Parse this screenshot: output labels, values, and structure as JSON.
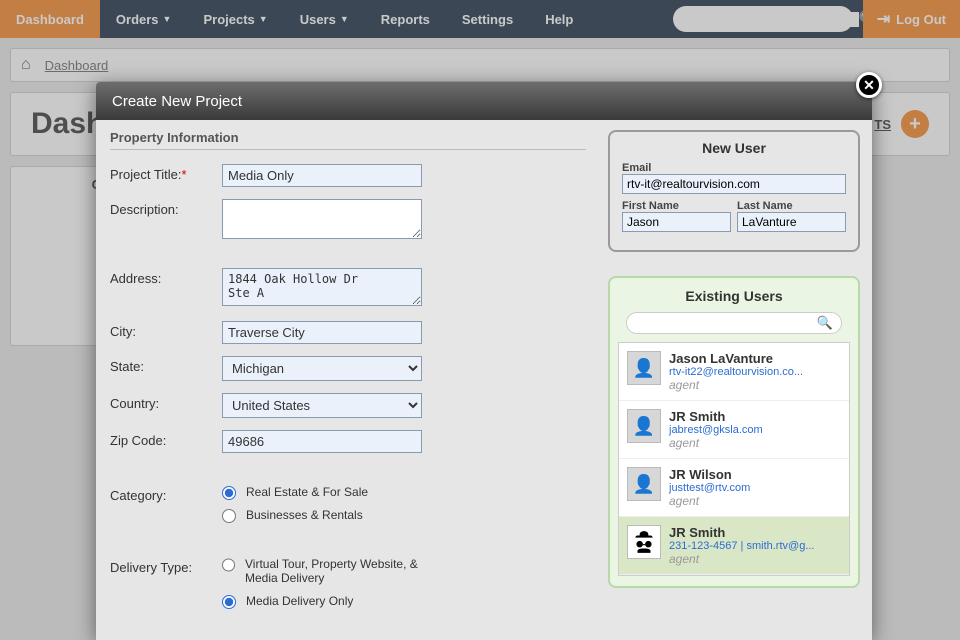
{
  "nav": {
    "items": [
      {
        "label": "Dashboard",
        "active": true,
        "dropdown": false
      },
      {
        "label": "Orders",
        "active": false,
        "dropdown": true
      },
      {
        "label": "Projects",
        "active": false,
        "dropdown": true
      },
      {
        "label": "Users",
        "active": false,
        "dropdown": true
      },
      {
        "label": "Reports",
        "active": false,
        "dropdown": false
      },
      {
        "label": "Settings",
        "active": false,
        "dropdown": false
      },
      {
        "label": "Help",
        "active": false,
        "dropdown": false
      }
    ],
    "search_placeholder": "",
    "logout": "Log Out"
  },
  "breadcrumb": {
    "items": [
      "Dashboard"
    ]
  },
  "page": {
    "title": "Dashboard",
    "tab_letters": "TS",
    "panel_caption": "Custo"
  },
  "modal": {
    "title": "Create New Project",
    "section": "Property Information",
    "labels": {
      "project_title": "Project Title:",
      "description": "Description:",
      "address": "Address:",
      "city": "City:",
      "state": "State:",
      "country": "Country:",
      "zip": "Zip Code:",
      "category": "Category:",
      "delivery": "Delivery Type:"
    },
    "values": {
      "project_title": "Media Only",
      "description": "",
      "address": "1844 Oak Hollow Dr\nSte A",
      "city": "Traverse City",
      "state": "Michigan",
      "country": "United States",
      "zip": "49686"
    },
    "category_options": [
      {
        "label": "Real Estate & For Sale",
        "checked": true
      },
      {
        "label": "Businesses & Rentals",
        "checked": false
      }
    ],
    "delivery_options": [
      {
        "label": "Virtual Tour, Property Website, & Media Delivery",
        "checked": false
      },
      {
        "label": "Media Delivery Only",
        "checked": true
      }
    ]
  },
  "new_user": {
    "title": "New User",
    "labels": {
      "email": "Email",
      "first": "First Name",
      "last": "Last Name"
    },
    "values": {
      "email": "rtv-it@realtourvision.com",
      "first": "Jason",
      "last": "LaVanture"
    }
  },
  "existing_users": {
    "title": "Existing Users",
    "search_value": "",
    "list": [
      {
        "name": "Jason LaVanture",
        "email": "rtv-it22@realtourvision.co...",
        "role": "agent",
        "selected": false,
        "avatar": "default"
      },
      {
        "name": "JR Smith",
        "email": "jabrest@gksla.com",
        "role": "agent",
        "selected": false,
        "avatar": "default"
      },
      {
        "name": "JR Wilson",
        "email": "justtest@rtv.com",
        "role": "agent",
        "selected": false,
        "avatar": "default"
      },
      {
        "name": "JR Smith",
        "email": "231-123-4567 | smith.rtv@g...",
        "role": "agent",
        "selected": true,
        "avatar": "spy"
      }
    ]
  }
}
